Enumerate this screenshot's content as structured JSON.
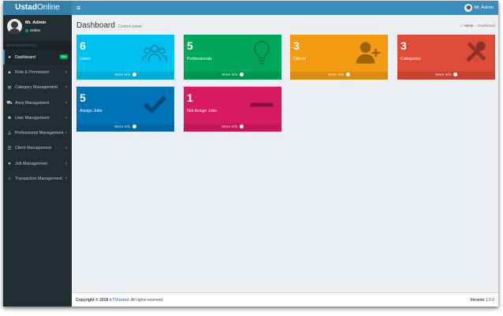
{
  "app": {
    "logo_bold": "Ustad",
    "logo_rest": "Online"
  },
  "topbar": {
    "menu_icon": "hamburger-icon",
    "username": "Mr. Admin"
  },
  "sidebar": {
    "user_name": "Mr. Admin",
    "user_status": "Online",
    "nav_header": "MAIN NAVIGATION",
    "items": [
      {
        "label": "Dashboard",
        "icon": "dashboard-icon",
        "badge": "new"
      },
      {
        "label": "Role & Permission",
        "icon": "lock-icon"
      },
      {
        "label": "Category Management",
        "icon": "wrench-icon"
      },
      {
        "label": "Area Management",
        "icon": "car-icon"
      },
      {
        "label": "User Management",
        "icon": "users-icon"
      },
      {
        "label": "Professional Management",
        "icon": "user-tie-icon"
      },
      {
        "label": "Client Management",
        "icon": "list-icon"
      },
      {
        "label": "Job Management",
        "icon": "comment-icon"
      },
      {
        "label": "Transaction Management",
        "icon": "bank-icon"
      }
    ]
  },
  "page": {
    "title": "Dashboard",
    "subtitle": "Control panel",
    "breadcrumb": {
      "home": "Home",
      "current": "Dashboard"
    }
  },
  "boxes": [
    {
      "value": "6",
      "label": "Users",
      "icon": "users-icon",
      "color": "#00c0ef",
      "more": "More info"
    },
    {
      "value": "5",
      "label": "Professionals",
      "icon": "lightbulb-icon",
      "color": "#00a65a",
      "more": "More info"
    },
    {
      "value": "3",
      "label": "Clients",
      "icon": "user-plus-icon",
      "color": "#f39c12",
      "more": "More info"
    },
    {
      "value": "3",
      "label": "Categories",
      "icon": "tools-icon",
      "color": "#dd4b39",
      "more": "More info"
    },
    {
      "value": "5",
      "label": "Assign Jobs",
      "icon": "checkmark-icon",
      "color": "#0073b7",
      "more": "More info"
    },
    {
      "value": "1",
      "label": "Not Assign Jobs",
      "icon": "minus-icon",
      "color": "#d81b60",
      "more": "More info"
    }
  ],
  "footer": {
    "copyright": "Copyright © 2018",
    "company": "IcTVission.",
    "rights": "All rights reserved.",
    "version_label": "Version",
    "version_value": "1.0.0"
  }
}
